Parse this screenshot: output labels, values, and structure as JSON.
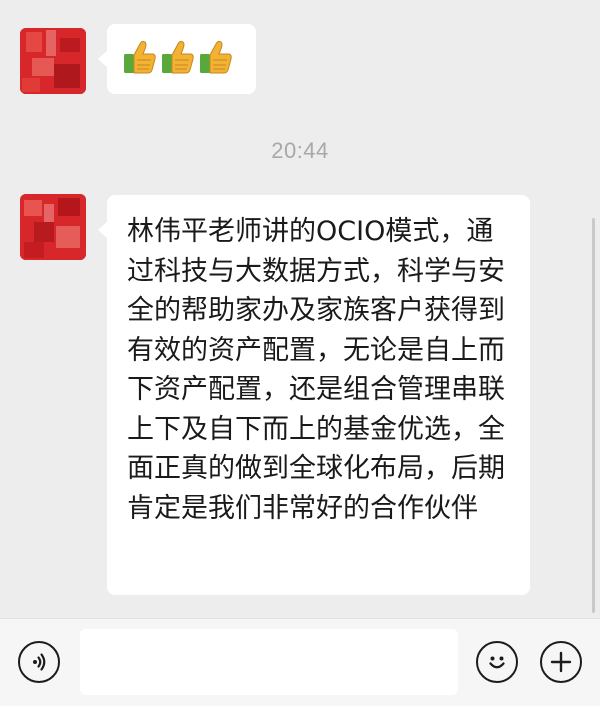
{
  "chat": {
    "messages": [
      {
        "type": "emoji",
        "icons": [
          "thumbs-up-icon",
          "thumbs-up-icon",
          "thumbs-up-icon"
        ]
      },
      {
        "type": "text",
        "text": "林伟平老师讲的OCIO模式，通过科技与大数据方式，科学与安全的帮助家办及家族客户获得到有效的资产配置，无论是自上而下资产配置，还是组合管理串联上下及自下而上的基金优选，全面正真的做到全球化布局，后期肯定是我们非常好的合作伙伴"
      }
    ],
    "timestamp": "20:44"
  },
  "input_bar": {
    "message_value": "",
    "voice_icon": "voice-icon",
    "emoji_icon": "smiley-icon",
    "more_icon": "plus-icon"
  },
  "colors": {
    "background": "#ededed",
    "bubble": "#ffffff",
    "timestamp": "#a8a8a8",
    "avatar": "#d8272a",
    "thumb": "#f2b234",
    "cuff": "#58a83c"
  }
}
